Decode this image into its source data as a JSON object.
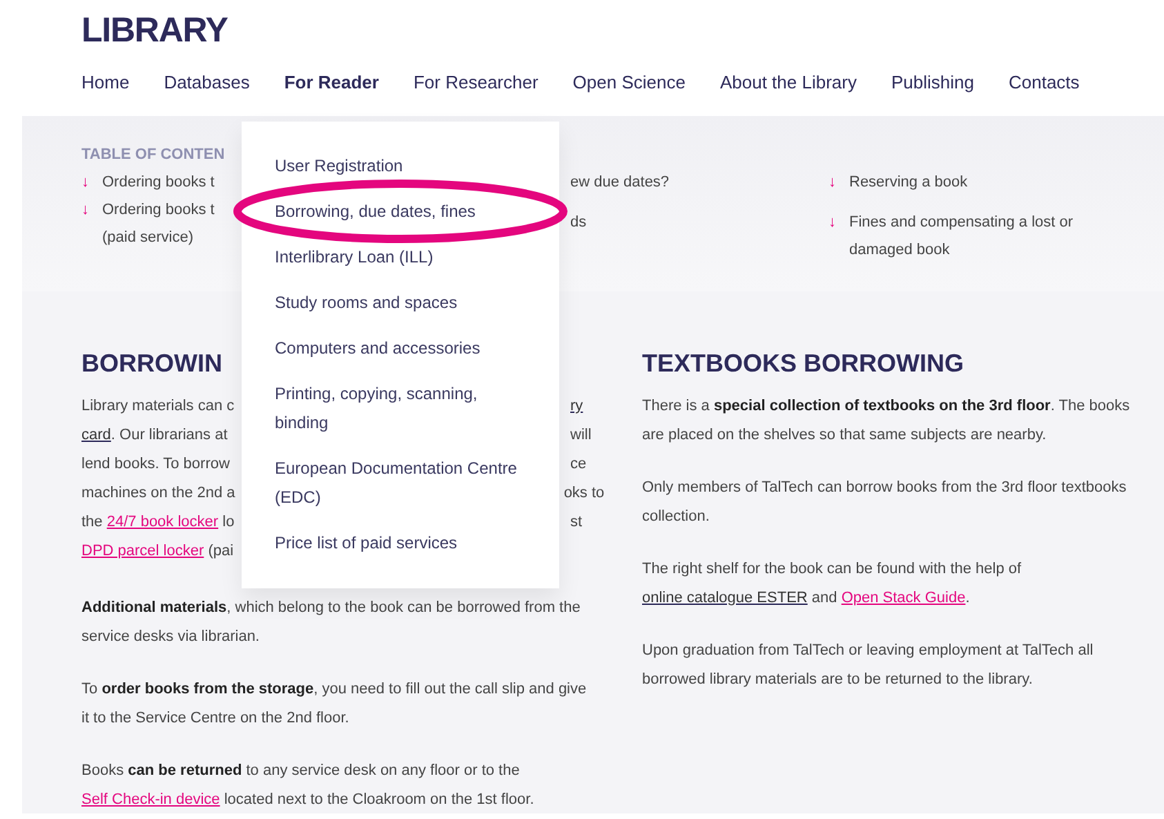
{
  "site_title": "LIBRARY",
  "nav": [
    {
      "label": "Home",
      "open": false
    },
    {
      "label": "Databases",
      "open": false
    },
    {
      "label": "For Reader",
      "open": true
    },
    {
      "label": "For Researcher",
      "open": false
    },
    {
      "label": "Open Science",
      "open": false
    },
    {
      "label": "About the Library",
      "open": false
    },
    {
      "label": "Publishing",
      "open": false
    },
    {
      "label": "Contacts",
      "open": false
    }
  ],
  "dropdown": {
    "items": [
      "User Registration",
      "Borrowing, due dates, fines",
      "Interlibrary Loan (ILL)",
      "Study rooms and spaces",
      "Computers and accessories",
      "Printing, copying, scanning, binding",
      "European Documentation Centre (EDC)",
      "Price list of paid services"
    ],
    "annotation": true
  },
  "toc": {
    "heading": "TABLE OF CONTEN",
    "column_1": [
      {
        "text": "Ordering books t",
        "arrow": "↓"
      },
      {
        "text": "Ordering books t",
        "arrow": "↓"
      },
      {
        "text": "(paid service)"
      }
    ],
    "column_2": [
      {
        "text": "ew due dates?"
      },
      {
        "text": "ds"
      }
    ],
    "column_3": [
      {
        "text": "Reserving a book",
        "arrow": "↓"
      },
      {
        "text": "Fines and compensating a lost or damaged book",
        "arrow": "↓"
      }
    ]
  },
  "borrowing": {
    "heading": "BORROWIN",
    "covered_lines": [
      {
        "left": [
          {
            "text": "Library materials can c",
            "kind": "plain"
          }
        ],
        "right": [
          {
            "text": "ry",
            "kind": "link"
          }
        ]
      },
      {
        "left": [
          {
            "text": "card",
            "kind": "link"
          },
          {
            "text": ". Our librarians at",
            "kind": "plain"
          }
        ],
        "right": [
          {
            "text": "will",
            "kind": "plain"
          }
        ]
      },
      {
        "left": [
          {
            "text": "lend books. To borrow",
            "kind": "plain"
          }
        ],
        "right": [
          {
            "text": "ce",
            "kind": "plain"
          }
        ]
      },
      {
        "left": [
          {
            "text": "machines on the 2nd a",
            "kind": "plain"
          }
        ],
        "right": [
          {
            "text": "oks to",
            "kind": "plain"
          }
        ]
      },
      {
        "left": [
          {
            "text": "the ",
            "kind": "plain"
          },
          {
            "text": "24/7 book locker",
            "kind": "accent_link"
          },
          {
            "text": " lo",
            "kind": "plain"
          }
        ],
        "right": [
          {
            "text": "st",
            "kind": "plain"
          }
        ]
      },
      {
        "left": [
          {
            "text": "DPD parcel locker",
            "kind": "accent_link"
          },
          {
            "text": " (pai",
            "kind": "plain"
          }
        ]
      }
    ],
    "paragraphs": [
      [
        {
          "text": "Additional materials",
          "kind": "bold"
        },
        {
          "text": ", which belong to the book can be borrowed from the service desks via librarian.",
          "kind": "plain"
        }
      ],
      [
        {
          "text": "To ",
          "kind": "plain"
        },
        {
          "text": "order books from the storage",
          "kind": "bold"
        },
        {
          "text": ", you need to fill out the call slip and give it to the Service Centre on the 2nd floor.",
          "kind": "plain"
        }
      ],
      [
        {
          "text": "Books ",
          "kind": "plain"
        },
        {
          "text": "can be returned",
          "kind": "bold"
        },
        {
          "text": " to any service desk on any floor or to the ",
          "kind": "plain"
        },
        {
          "text": "Self Check-in device",
          "kind": "accent_link"
        },
        {
          "text": " located next to the Cloakroom on the 1st floor.",
          "kind": "plain"
        }
      ]
    ]
  },
  "textbooks": {
    "heading": "TEXTBOOKS BORROWING",
    "paragraphs": [
      [
        {
          "text": "There is a ",
          "kind": "plain"
        },
        {
          "text": "special collection of textbooks on the 3rd floor",
          "kind": "bold"
        },
        {
          "text": ". The books are placed on the shelves so that same subjects are nearby.",
          "kind": "plain"
        }
      ],
      [
        {
          "text": "Only members of TalTech can borrow books from the 3rd floor textbooks collection.",
          "kind": "plain"
        }
      ],
      [
        {
          "text": "The right shelf for the book can be found with the help of ",
          "kind": "plain"
        },
        {
          "text": "online catalogue ESTER",
          "kind": "link"
        },
        {
          "text": " and ",
          "kind": "plain"
        },
        {
          "text": "Open Stack Guide",
          "kind": "accent_link"
        },
        {
          "text": ".",
          "kind": "plain"
        }
      ],
      [
        {
          "text": "Upon graduation from TalTech or leaving employment at TalTech all borrowed library materials are to be returned to the library.",
          "kind": "plain"
        }
      ]
    ]
  }
}
